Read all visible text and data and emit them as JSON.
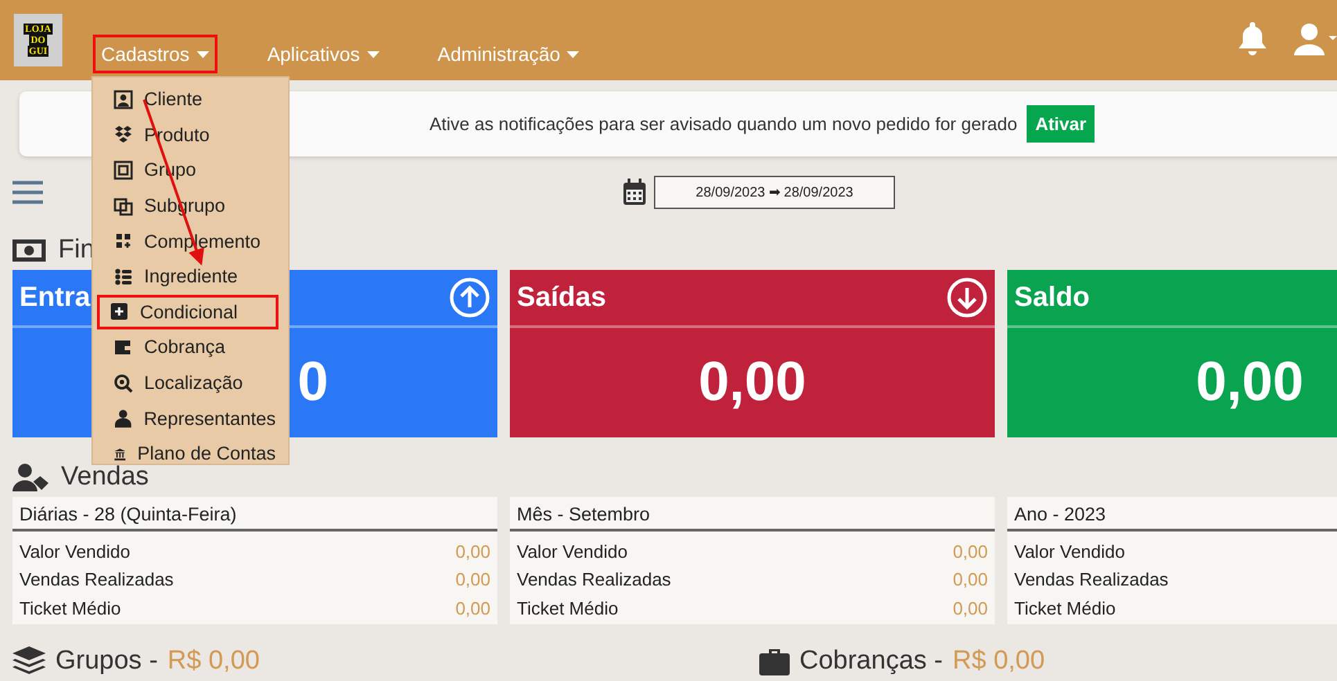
{
  "navbar": {
    "logo": [
      "LOJA",
      "DO",
      "GUI"
    ],
    "menus": [
      {
        "label": "Cadastros",
        "highlighted": true
      },
      {
        "label": "Aplicativos",
        "highlighted": false
      },
      {
        "label": "Administração",
        "highlighted": false
      }
    ]
  },
  "dropdown": {
    "items": [
      {
        "label": "Cliente",
        "highlighted": false
      },
      {
        "label": "Produto",
        "highlighted": false
      },
      {
        "label": "Grupo",
        "highlighted": false
      },
      {
        "label": "Subgrupo",
        "highlighted": false
      },
      {
        "label": "Complemento",
        "highlighted": false
      },
      {
        "label": "Ingrediente",
        "highlighted": false
      },
      {
        "label": "Condicional",
        "highlighted": true
      },
      {
        "label": "Cobrança",
        "highlighted": false
      },
      {
        "label": "Localização",
        "highlighted": false
      },
      {
        "label": "Representantes",
        "highlighted": false
      },
      {
        "label": "Plano de Contas",
        "highlighted": false
      }
    ]
  },
  "annotation_arrow": true,
  "notification": {
    "message": "Ative as notificações para ser avisado quando um novo pedido for gerado",
    "button": "Ativar"
  },
  "date_range": "28/09/2023 ➡ 28/09/2023",
  "finance": {
    "heading": "Fin",
    "cards": [
      {
        "title": "Entra",
        "value": "0",
        "kind": "income",
        "color": "#2a78f5"
      },
      {
        "title": "Saídas",
        "value": "0,00",
        "kind": "expense",
        "color": "#c0213b"
      },
      {
        "title": "Saldo",
        "value": "0,00",
        "kind": "balance",
        "color": "#0aa350"
      }
    ]
  },
  "sales": {
    "heading": "Vendas",
    "cards": [
      {
        "title": "Diárias - 28 (Quinta-Feira)",
        "rows": [
          {
            "label": "Valor Vendido",
            "value": "0,00"
          },
          {
            "label": "Vendas Realizadas",
            "value": "0,00"
          },
          {
            "label": "Ticket Médio",
            "value": "0,00"
          }
        ]
      },
      {
        "title": "Mês - Setembro",
        "rows": [
          {
            "label": "Valor Vendido",
            "value": "0,00"
          },
          {
            "label": "Vendas Realizadas",
            "value": "0,00"
          },
          {
            "label": "Ticket Médio",
            "value": "0,00"
          }
        ]
      },
      {
        "title": "Ano - 2023",
        "rows": [
          {
            "label": "Valor Vendido"
          },
          {
            "label": "Vendas Realizadas"
          },
          {
            "label": "Ticket Médio"
          }
        ]
      }
    ]
  },
  "summaries": [
    {
      "label": "Grupos -",
      "amount": "R$ 0,00"
    },
    {
      "label": "Cobranças -",
      "amount": "R$ 0,00"
    }
  ]
}
